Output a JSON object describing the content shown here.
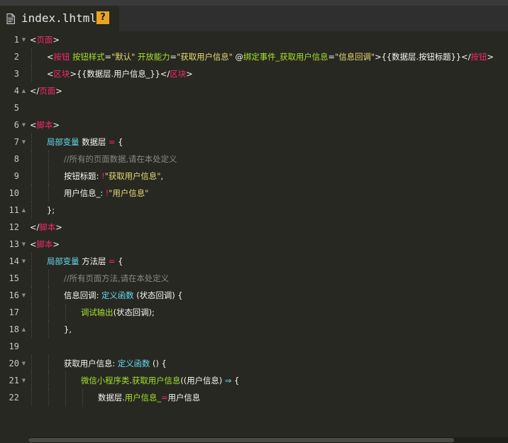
{
  "tab": {
    "title": "index.lhtml",
    "badge": "?",
    "file_icon": "file-icon",
    "badge_color": "#e9a422"
  },
  "colors": {
    "background": "#272822",
    "tag": "#f92672",
    "attribute": "#a6e22e",
    "string": "#e6db74",
    "keyword": "#66d9ef",
    "comment": "#8a8a80"
  },
  "lines": [
    {
      "n": "1",
      "fold": "down",
      "indent": 0,
      "tokens": [
        [
          "t-text",
          "<"
        ],
        [
          "t-tag",
          "页面"
        ],
        [
          "t-text",
          ">"
        ]
      ]
    },
    {
      "n": "2",
      "fold": "",
      "indent": 1,
      "tokens": [
        [
          "t-text",
          "<"
        ],
        [
          "t-tag",
          "按钮 "
        ],
        [
          "t-attr",
          "按钮样式"
        ],
        [
          "t-text",
          "="
        ],
        [
          "t-str",
          "\"默认\" "
        ],
        [
          "t-attr",
          "开放能力"
        ],
        [
          "t-text",
          "="
        ],
        [
          "t-str",
          "\"获取用户信息\" "
        ],
        [
          "t-text",
          "@"
        ],
        [
          "t-attr",
          "绑定事件_获取用户信息"
        ],
        [
          "t-text",
          "="
        ],
        [
          "t-str",
          "\"信息回调\""
        ],
        [
          "t-text",
          ">{{数据层.按钮标题}}</"
        ],
        [
          "t-tag",
          "按钮"
        ],
        [
          "t-text",
          ">"
        ]
      ]
    },
    {
      "n": "3",
      "fold": "",
      "indent": 1,
      "tokens": [
        [
          "t-text",
          "<"
        ],
        [
          "t-tag",
          "区块"
        ],
        [
          "t-text",
          ">{{数据层.用户信息_}}</"
        ],
        [
          "t-tag",
          "区块"
        ],
        [
          "t-text",
          ">"
        ]
      ]
    },
    {
      "n": "4",
      "fold": "up",
      "indent": 0,
      "tokens": [
        [
          "t-text",
          "</"
        ],
        [
          "t-tag",
          "页面"
        ],
        [
          "t-text",
          ">"
        ]
      ]
    },
    {
      "n": "5",
      "fold": "",
      "indent": 0,
      "tokens": []
    },
    {
      "n": "6",
      "fold": "down",
      "indent": 0,
      "tokens": [
        [
          "t-text",
          "<"
        ],
        [
          "t-tag",
          "脚本"
        ],
        [
          "t-text",
          ">"
        ]
      ]
    },
    {
      "n": "7",
      "fold": "down",
      "indent": 1,
      "tokens": [
        [
          "t-kw",
          "局部变量 "
        ],
        [
          "t-text",
          "数据层 "
        ],
        [
          "t-op",
          "="
        ],
        [
          "t-text",
          " {"
        ]
      ]
    },
    {
      "n": "8",
      "fold": "",
      "indent": 2,
      "tokens": [
        [
          "t-cmt",
          "//所有的页面数据,请在本处定义"
        ]
      ]
    },
    {
      "n": "9",
      "fold": "",
      "indent": 2,
      "tokens": [
        [
          "t-text",
          "按钮标题: "
        ],
        [
          "t-op",
          "!"
        ],
        [
          "t-str",
          "\"获取用户信息\""
        ],
        [
          "t-text",
          ","
        ]
      ]
    },
    {
      "n": "10",
      "fold": "",
      "indent": 2,
      "tokens": [
        [
          "t-text",
          "用户信息_: "
        ],
        [
          "t-op",
          "!"
        ],
        [
          "t-str",
          "\"用户信息\""
        ]
      ]
    },
    {
      "n": "11",
      "fold": "up",
      "indent": 1,
      "tokens": [
        [
          "t-text",
          "};"
        ]
      ]
    },
    {
      "n": "12",
      "fold": "",
      "indent": 0,
      "tokens": [
        [
          "t-text",
          "</"
        ],
        [
          "t-tag",
          "脚本"
        ],
        [
          "t-text",
          ">"
        ]
      ]
    },
    {
      "n": "13",
      "fold": "down",
      "indent": 0,
      "tokens": [
        [
          "t-text",
          "<"
        ],
        [
          "t-tag",
          "脚本"
        ],
        [
          "t-text",
          ">"
        ]
      ]
    },
    {
      "n": "14",
      "fold": "down",
      "indent": 1,
      "tokens": [
        [
          "t-kw",
          "局部变量 "
        ],
        [
          "t-text",
          "方法层 "
        ],
        [
          "t-op",
          "="
        ],
        [
          "t-text",
          " {"
        ]
      ]
    },
    {
      "n": "15",
      "fold": "",
      "indent": 2,
      "tokens": [
        [
          "t-cmt",
          "//所有页面方法,请在本处定义"
        ]
      ]
    },
    {
      "n": "16",
      "fold": "down",
      "indent": 2,
      "tokens": [
        [
          "t-text",
          "信息回调: "
        ],
        [
          "t-kw",
          "定义函数 "
        ],
        [
          "t-text",
          "(状态回调) {"
        ]
      ]
    },
    {
      "n": "17",
      "fold": "",
      "indent": 3,
      "tokens": [
        [
          "t-func",
          "调试输出"
        ],
        [
          "t-text",
          "(状态回调);"
        ]
      ]
    },
    {
      "n": "18",
      "fold": "up",
      "indent": 2,
      "tokens": [
        [
          "t-text",
          "},"
        ]
      ]
    },
    {
      "n": "19",
      "fold": "",
      "indent": 0,
      "tokens": []
    },
    {
      "n": "20",
      "fold": "down",
      "indent": 2,
      "tokens": [
        [
          "t-text",
          "获取用户信息: "
        ],
        [
          "t-kw",
          "定义函数 "
        ],
        [
          "t-text",
          "() {"
        ]
      ]
    },
    {
      "n": "21",
      "fold": "down",
      "indent": 3,
      "tokens": [
        [
          "t-func",
          "微信小程序类"
        ],
        [
          "t-text",
          "."
        ],
        [
          "t-func",
          "获取用户信息"
        ],
        [
          "t-text",
          "((用户信息) "
        ],
        [
          "t-kw",
          "⇒"
        ],
        [
          "t-text",
          " {"
        ]
      ]
    },
    {
      "n": "22",
      "fold": "",
      "indent": 4,
      "tokens": [
        [
          "t-text",
          "数据层."
        ],
        [
          "t-func",
          "用户信息_"
        ],
        [
          "t-op",
          "="
        ],
        [
          "t-text",
          "用户信息"
        ]
      ]
    }
  ]
}
